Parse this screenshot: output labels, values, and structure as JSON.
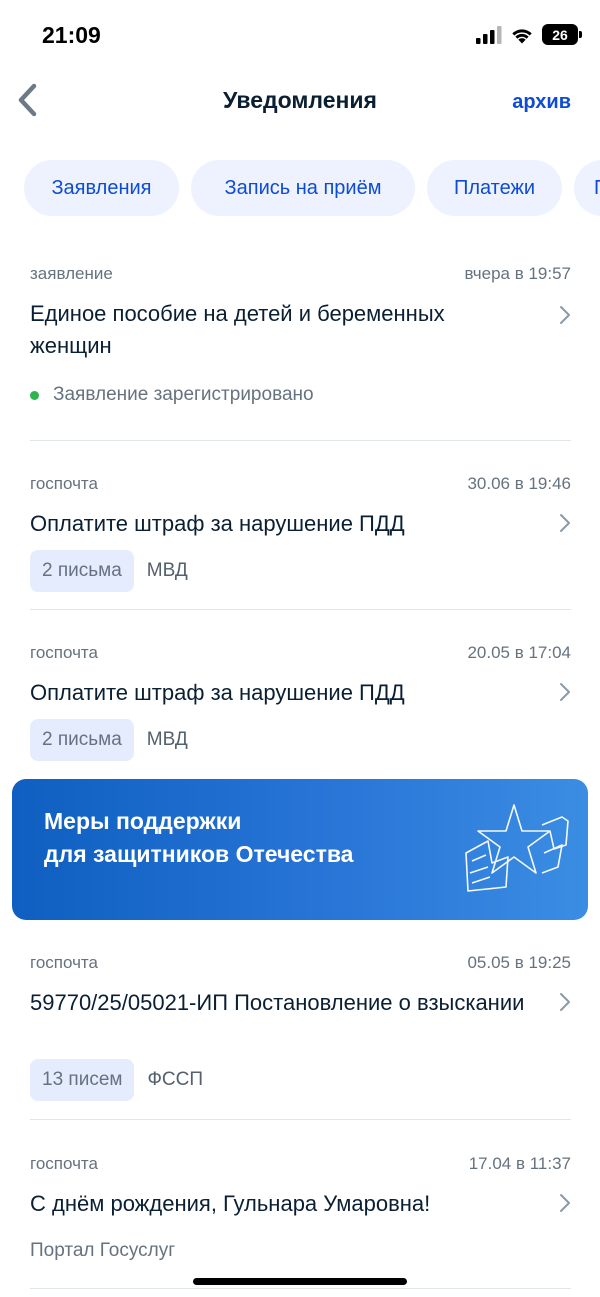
{
  "status_bar": {
    "time": "21:09",
    "battery": "26"
  },
  "nav": {
    "title": "Уведомления",
    "archive": "архив"
  },
  "chips": [
    "Заявления",
    "Запись на приём",
    "Платежи",
    "П"
  ],
  "items": [
    {
      "type": "заявление",
      "date": "вчера в 19:57",
      "title": "Единое пособие на детей и беременных женщин",
      "status": "Заявление зарегистрировано"
    },
    {
      "type": "госпочта",
      "date": "30.06 в 19:46",
      "title": "Оплатите штраф за нарушение ПДД",
      "badge": "2 письма",
      "sender": "МВД"
    },
    {
      "type": "госпочта",
      "date": "20.05 в 17:04",
      "title": "Оплатите штраф за нарушение ПДД",
      "badge": "2 письма",
      "sender": "МВД"
    },
    {
      "type": "госпочта",
      "date": "05.05 в 19:25",
      "title": "59770/25/05021-ИП Постановление о взыскании",
      "badge": "13 писем",
      "sender": "ФССП"
    },
    {
      "type": "госпочта",
      "date": "17.04 в 11:37",
      "title": "С днём рождения, Гульнара Умаровна!",
      "sender": "Портал Госуслуг"
    }
  ],
  "banner": {
    "line1": "Меры поддержки",
    "line2": "для защитников Отечества"
  },
  "colors": {
    "accent": "#0d4cd3",
    "chip_bg": "#edf2fe",
    "status_dot": "#2cb64d",
    "banner": "#1565c8"
  },
  "icons": {
    "back": "chevron-left-icon",
    "item_arrow": "chevron-right-icon",
    "signal": "cellular-signal-icon",
    "wifi": "wifi-icon",
    "banner_art": "star-flag-icon"
  }
}
